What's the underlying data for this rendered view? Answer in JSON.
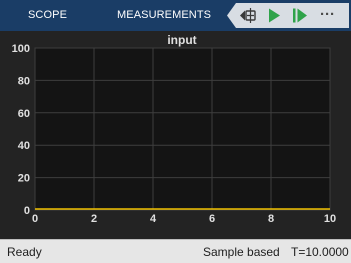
{
  "toolstrip": {
    "tabs": [
      {
        "label": "SCOPE"
      },
      {
        "label": "MEASUREMENTS"
      }
    ],
    "quick_access": [
      {
        "icon": "step-back-icon"
      },
      {
        "icon": "run-icon"
      },
      {
        "icon": "step-forward-icon"
      },
      {
        "icon": "more-options-icon",
        "label": "···"
      }
    ],
    "background": "#1a3d66"
  },
  "plot": {
    "title": "input",
    "x_ticks": [
      "0",
      "2",
      "4",
      "6",
      "8",
      "10"
    ],
    "y_ticks": [
      "0",
      "20",
      "40",
      "60",
      "80",
      "100"
    ],
    "colors": {
      "figure": "#232323",
      "axes": "#141414",
      "grid": "#3e3e3e",
      "text": "#e0e0e0",
      "trace": "#f2c200"
    }
  },
  "chart_data": {
    "type": "line",
    "title": "input",
    "xlabel": "",
    "ylabel": "",
    "xlim": [
      0,
      10
    ],
    "ylim": [
      0,
      100
    ],
    "grid": true,
    "series": [
      {
        "x": [
          0,
          10
        ],
        "y": [
          0,
          0
        ],
        "color": "#f2c200"
      }
    ]
  },
  "statusbar": {
    "status": "Ready",
    "mode": "Sample based",
    "time": "T=10.0000"
  }
}
